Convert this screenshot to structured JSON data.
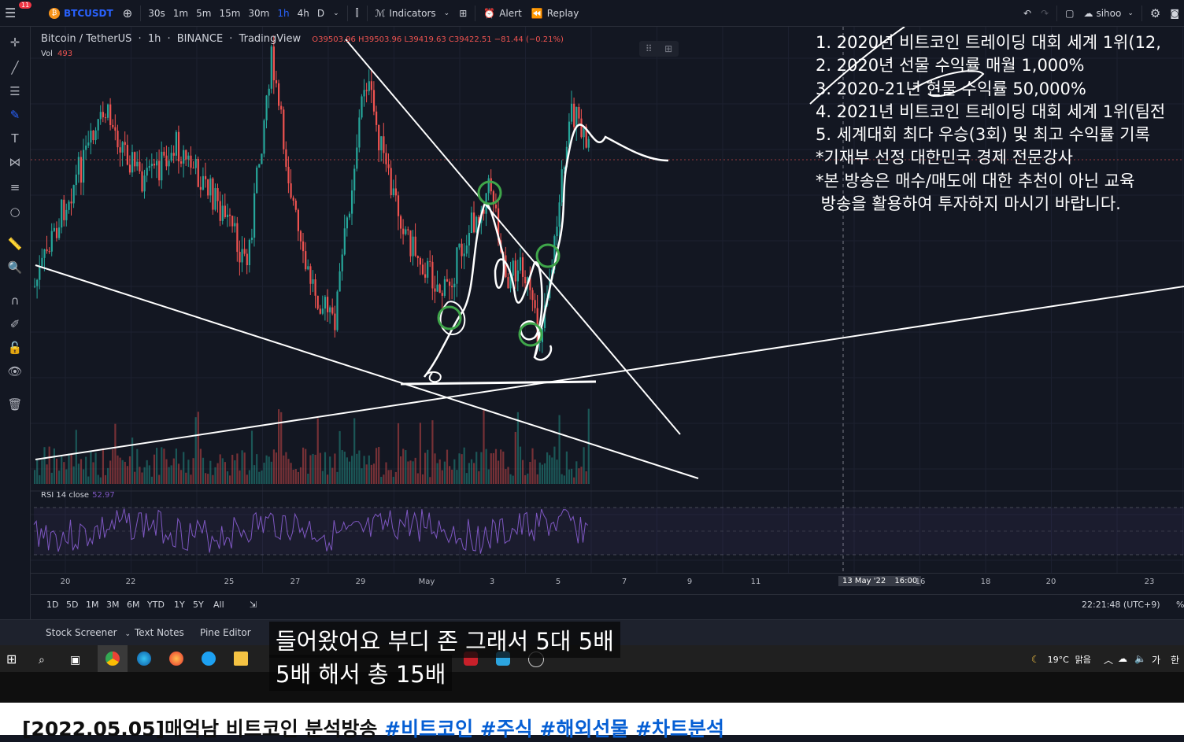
{
  "topbar": {
    "notification_count": "11",
    "symbol": "BTCUSDT",
    "timeframes": [
      "30s",
      "1m",
      "5m",
      "15m",
      "30m",
      "1h",
      "4h",
      "D"
    ],
    "active_timeframe": "1h",
    "indicators_label": "Indicators",
    "alert_label": "Alert",
    "replay_label": "Replay",
    "user_label": "sihoo"
  },
  "legend": {
    "pair": "Bitcoin / TetherUS",
    "interval": "1h",
    "exchange": "BINANCE",
    "provider": "TradingView",
    "ohlc": "O39503.96 H39503.96 L39419.63 C39422.51 −81.44 (−0.21%)",
    "volume_label": "Vol",
    "volume_value": "493",
    "rsi_label": "RSI 14 close",
    "rsi_value": "52.97"
  },
  "notes": [
    "1. 2020년 비트코인 트레이딩 대회 세계 1위(12,",
    "2. 2020년 선물 수익률 매월 1,000%",
    "3. 2020-21년 현물 수익률 50,000%",
    "4. 2021년 비트코인 트레이딩 대회 세계 1위(팀전",
    "5. 세계대회 최다 우승(3회) 및 최고 수익률 기록",
    "*기재부 선정 대한민국 경제 전문강사",
    "*본 방송은 매수/매도에 대한 추천이 아닌 교육",
    " 방송을 활용하여 투자하지 마시기 바랍니다."
  ],
  "xaxis": {
    "labels": [
      "20",
      "22",
      "25",
      "27",
      "29",
      "May",
      "3",
      "5",
      "7",
      "9",
      "11",
      "16",
      "18",
      "20",
      "23"
    ],
    "cursor_date": "13 May '22",
    "cursor_time": "16:00"
  },
  "bottom": {
    "ranges": [
      "1D",
      "5D",
      "1M",
      "3M",
      "6M",
      "YTD",
      "1Y",
      "5Y",
      "All"
    ],
    "clock": "22:21:48 (UTC+9)",
    "percent": "%"
  },
  "panel_tabs": [
    "Stock Screener",
    "Text Notes",
    "Pine Editor"
  ],
  "taskbar": {
    "weather_temp": "19°C",
    "weather_desc": "맑음",
    "ime": "가",
    "lang": "한"
  },
  "subtitles": {
    "line1": "들어왔어요 부디 존 그래서 5대 5배",
    "line2": "5배 해서 총 15배"
  },
  "video": {
    "title_prefix": "[2022.05.05]매억남 비트코인 분석방송 ",
    "hashtags": "#비트코인 #주식 #해외선물 #차트분석"
  },
  "colors": {
    "background": "#131722",
    "up": "#26a69a",
    "down": "#ef5350",
    "accent": "#2962ff",
    "rsi": "#7e57c2",
    "annotation": "#ffffff",
    "circle": "#3fa64a"
  }
}
